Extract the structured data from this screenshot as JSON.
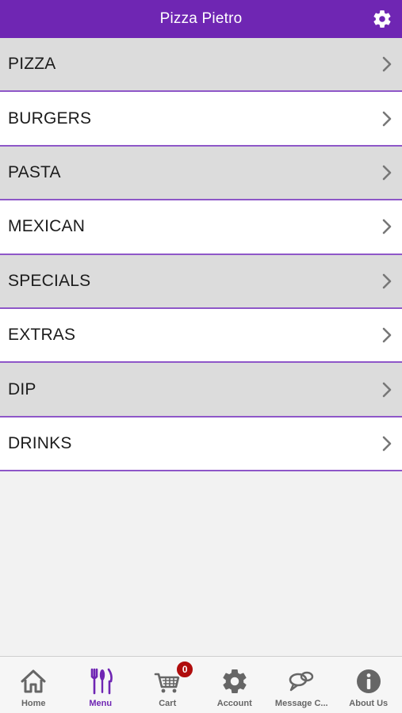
{
  "app": {
    "title": "Pizza Pietro"
  },
  "menu": {
    "items": [
      {
        "label": "PIZZA"
      },
      {
        "label": "BURGERS"
      },
      {
        "label": "PASTA"
      },
      {
        "label": "MEXICAN"
      },
      {
        "label": "SPECIALS"
      },
      {
        "label": "EXTRAS"
      },
      {
        "label": "DIP"
      },
      {
        "label": "DRINKS"
      }
    ]
  },
  "tabs": [
    {
      "label": "Home",
      "icon": "home-icon"
    },
    {
      "label": "Menu",
      "icon": "fork-knife-icon",
      "active": true
    },
    {
      "label": "Cart",
      "icon": "cart-icon",
      "badge": "0"
    },
    {
      "label": "Account",
      "icon": "gear-icon"
    },
    {
      "label": "Message C...",
      "icon": "chat-bubbles-icon"
    },
    {
      "label": "About Us",
      "icon": "info-icon"
    }
  ],
  "colors": {
    "brand": "#6f26b3",
    "row_shade": "#dcdcdc",
    "row_light": "#ffffff",
    "divider": "#8e57c8",
    "badge": "#b00d0d"
  }
}
